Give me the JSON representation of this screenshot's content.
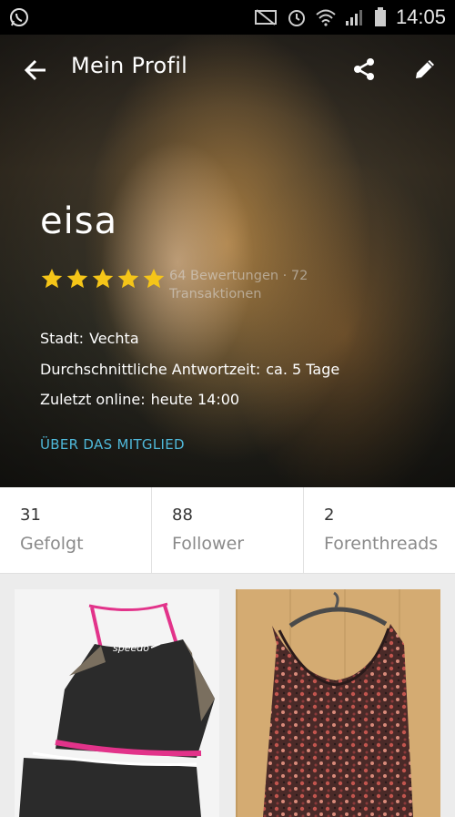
{
  "status_bar": {
    "time": "14:05",
    "icons": [
      "whatsapp-icon",
      "mute-icon",
      "alarm-icon",
      "wifi-icon",
      "signal-icon",
      "battery-icon"
    ]
  },
  "header": {
    "title": "Mein Profil"
  },
  "profile": {
    "username": "eisa",
    "stars": 5,
    "rating_text": "64 Bewertungen · 72 Transaktionen",
    "city_label": "Stadt:",
    "city_value": "Vechta",
    "response_label": "Durchschnittliche Antwortzeit:",
    "response_value": "ca. 5 Tage",
    "last_online_label": "Zuletzt online:",
    "last_online_value": "heute 14:00",
    "about_link": "ÜBER DAS MITGLIED"
  },
  "stats": [
    {
      "count": "31",
      "label": "Gefolgt"
    },
    {
      "count": "88",
      "label": "Follower"
    },
    {
      "count": "2",
      "label": "Forenthreads"
    }
  ],
  "colors": {
    "accent_link": "#4fb8d9",
    "star": "#f5c518",
    "background": "#ececec"
  }
}
